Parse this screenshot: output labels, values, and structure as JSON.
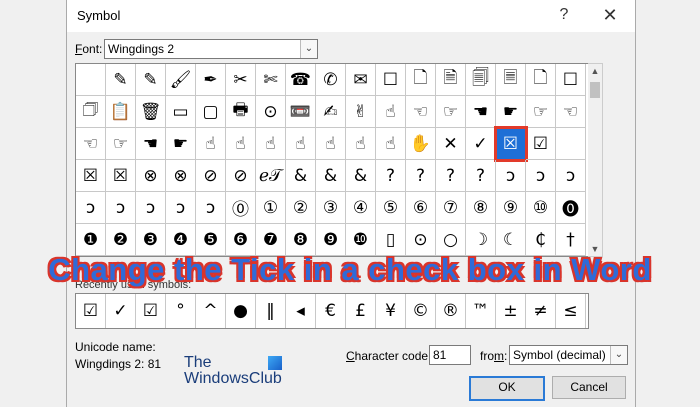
{
  "window": {
    "title": "Symbol",
    "help_glyph": "?",
    "close_glyph": "✕"
  },
  "font": {
    "label_u": "F",
    "label_rest": "ont:",
    "value": "Wingdings 2"
  },
  "grid": {
    "symbols": [
      "",
      "✎",
      "✎",
      "🖌",
      "✒",
      "✂",
      "✄",
      "☎",
      "✆",
      "✉",
      "☐",
      "🗋",
      "🗎",
      "🗐",
      "🗏",
      "🗋",
      "☐",
      "🗇",
      "📋",
      "🗑",
      "▭",
      "▢",
      "🖶",
      "⊙",
      "📼",
      "✍",
      "✌",
      "☝",
      "☜",
      "☞",
      "☚",
      "☛",
      "☞",
      "☜",
      "☜",
      "☞",
      "☚",
      "☛",
      "☝",
      "☝",
      "☝",
      "☝",
      "☝",
      "☝",
      "☝",
      "✋",
      "✕",
      "✓",
      "☒",
      "☑",
      "",
      "☒",
      "☒",
      "⊗",
      "⊗",
      "⊘",
      "⊘",
      "ℯ𝒯",
      "&",
      "&",
      "&",
      "?",
      "?",
      "?",
      "?",
      "ↄ",
      "ↄ",
      "ↄ",
      "ↄ",
      "ↄ",
      "ↄ",
      "ↄ",
      "ↄ",
      "⓪",
      "①",
      "②",
      "③",
      "④",
      "⑤",
      "⑥",
      "⑦",
      "⑧",
      "⑨",
      "⑩",
      "⓿",
      "❶",
      "❷",
      "❸",
      "❹",
      "❺",
      "❻",
      "❼",
      "❽",
      "❾",
      "❿",
      "▯",
      "⊙",
      "○",
      "☽",
      "☾",
      "₵",
      "†"
    ],
    "selected_index": 48
  },
  "banner": "Change the Tick in a check box in Word",
  "recent": {
    "label": "Recently used symbols:",
    "symbols": [
      "☑",
      "✓",
      "☑",
      "°",
      "^",
      "●",
      "‖",
      "◂",
      "€",
      "£",
      "¥",
      "©",
      "®",
      "™",
      "±",
      "≠",
      "≤"
    ]
  },
  "unicode": {
    "label": "Unicode name:",
    "value": "Wingdings 2: 81"
  },
  "logo": {
    "line1": "The",
    "line2": "WindowsClub"
  },
  "char_code": {
    "label_pre": "",
    "label_u": "C",
    "label_rest": "haracter code:",
    "value": "81"
  },
  "from": {
    "label_pre": "fro",
    "label_u": "m",
    "label_rest": ":",
    "value": "Symbol (decimal)"
  },
  "buttons": {
    "ok": "OK",
    "cancel": "Cancel"
  },
  "scroll": {
    "up": "▲",
    "down": "▼"
  },
  "select_arrow": "⌄",
  "colors": {
    "selection": "#1e6fd6",
    "highlight": "#e23a2a",
    "banner": "#2f6bd8"
  }
}
